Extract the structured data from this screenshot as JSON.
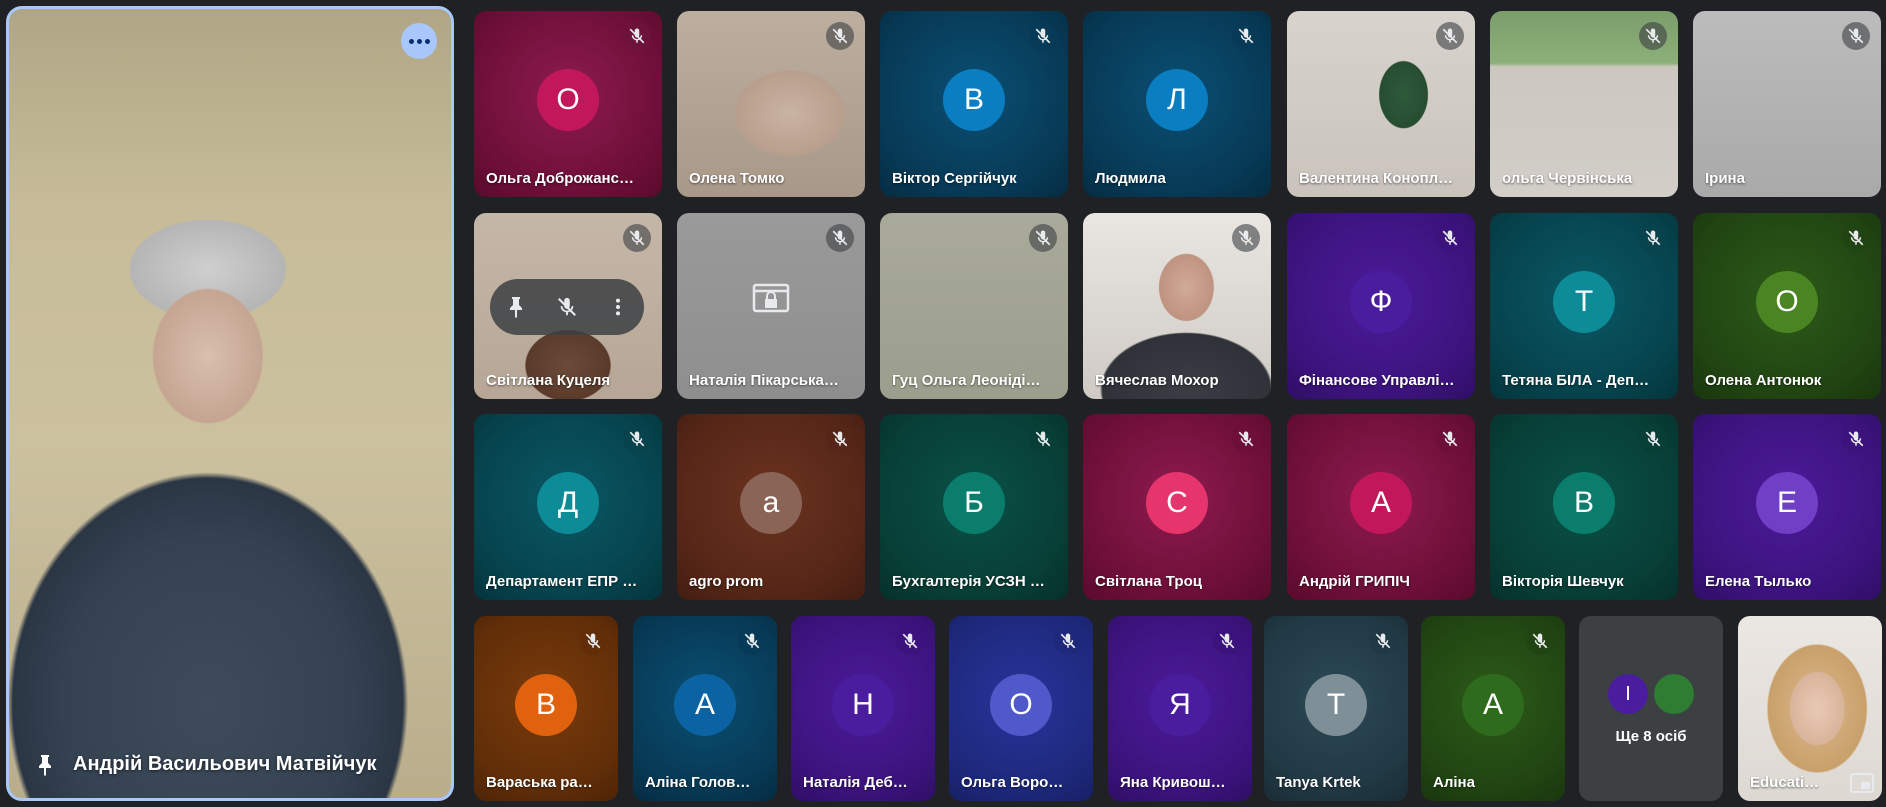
{
  "featured": {
    "name": "Андрій Васильович Матвійчук",
    "icons": {
      "pin": "pin-icon",
      "more": "more-options-icon"
    }
  },
  "colors": {
    "accent": "#a8c7fa",
    "background": "#202124"
  },
  "tiles": [
    {
      "name": "Ольга Доброжанс…",
      "initial": "О",
      "bg": "radial-gradient(circle at 50% 45%, #8e1b4f 0%, #6d0f38 70%, #5a0a2d 100%)",
      "avatar": "#c2185b",
      "mic": "#6d1339"
    },
    {
      "name": "Олена Томко",
      "initial": "",
      "bg": "radial-gradient(ellipse 90px 70px at 60% 55%, #c9b3a3 0%, #b89f8d 60%, transparent 62%), linear-gradient(180deg,#bdae9f,#a89888)",
      "avatar": "",
      "mic": "rgba(60,64,67,.6)"
    },
    {
      "name": "Віктор Сергійчук",
      "initial": "В",
      "bg": "radial-gradient(circle at 50% 45%, #0a4f73 0%, #073a56 70%, #052c42 100%)",
      "avatar": "#0b7dc1",
      "mic": "#073a56"
    },
    {
      "name": "Людмила",
      "initial": "Л",
      "bg": "radial-gradient(circle at 50% 45%, #0a4f73 0%, #073a56 70%, #052c42 100%)",
      "avatar": "#0b7dc1",
      "mic": "#073a56"
    },
    {
      "name": "Валентина Конопл…",
      "initial": "",
      "bg": "radial-gradient(ellipse 40px 55px at 62% 45%, #2e5a3a 0%, #274d31 60%, transparent 62%), linear-gradient(180deg,#d8d3cd,#c9c3bc)",
      "avatar": "",
      "mic": "rgba(60,64,67,.6)"
    },
    {
      "name": "ольга Червінська",
      "initial": "",
      "bg": "linear-gradient(180deg,#7a9d6a 0%,#8db07a 28%,#ccc7bf 30%,#d2cec8 100%)",
      "avatar": "",
      "mic": "rgba(60,64,67,.6)"
    },
    {
      "name": "Ірина",
      "initial": "",
      "bg": "linear-gradient(180deg,#bcbcbc,#a9a9a9)",
      "avatar": "",
      "mic": "rgba(60,64,67,.6)"
    },
    {
      "name": "Світлана Куцеля",
      "initial": "",
      "bg": "radial-gradient(ellipse 60px 50px at 50% 82%, #6b4a39 0%, #5a3a2a 70%, transparent 72%), linear-gradient(180deg,#c5b7a8,#b7a696)",
      "avatar": "",
      "mic": "rgba(60,64,67,.6)",
      "hover": true
    },
    {
      "name": "Наталія Пікарська…",
      "initial": "",
      "bg": "linear-gradient(180deg,#9a9a9a,#8e8e8e)",
      "avatar": "",
      "mic": "rgba(60,64,67,.6)",
      "lock": true
    },
    {
      "name": "Гуц Ольга Леоніді…",
      "initial": "",
      "bg": "linear-gradient(180deg,#a9aa9a,#9c9e8d)",
      "avatar": "",
      "mic": "rgba(60,64,67,.6)"
    },
    {
      "name": "Вячеслав Мохор",
      "initial": "",
      "bg": "radial-gradient(ellipse 45px 55px at 55% 40%, #d1aa98 0%, #bf9380 60%, transparent 62%), radial-gradient(ellipse 120px 80px at 55% 95%, #3a3d44 0%, #2f3238 70%, transparent 72%), linear-gradient(180deg,#e9e6e2,#cfcac4)",
      "avatar": "",
      "mic": "rgba(60,64,67,.6)"
    },
    {
      "name": "Фінансове Управлі…",
      "initial": "Ф",
      "bg": "radial-gradient(circle at 50% 45%, #4b1b9a 0%, #3c137d 70%, #300e66 100%)",
      "avatar": "#4a1c9e",
      "mic": "#3c137d"
    },
    {
      "name": "Тетяна БІЛА - Деп…",
      "initial": "Т",
      "bg": "radial-gradient(circle at 50% 45%, #0a5864 0%, #06434d 70%, #04343c 100%)",
      "avatar": "#0d8b97",
      "mic": "#06434d"
    },
    {
      "name": "Олена Антонюк",
      "initial": "О",
      "bg": "radial-gradient(circle at 50% 45%, #2c5a18 0%, #214512 70%, #19360d 100%)",
      "avatar": "#4a8423",
      "mic": "#214512"
    },
    {
      "name": "Департамент ЕПР …",
      "initial": "Д",
      "bg": "radial-gradient(circle at 50% 45%, #0a5864 0%, #06434d 70%, #04343c 100%)",
      "avatar": "#0d8b97",
      "mic": "#06434d"
    },
    {
      "name": "agro prom",
      "initial": "a",
      "bg": "radial-gradient(circle at 50% 45%, #6b3320 0%, #552617 70%, #431d11 100%)",
      "avatar": "#8a6557",
      "mic": "#552617"
    },
    {
      "name": "Бухгалтерія УСЗН …",
      "initial": "Б",
      "bg": "radial-gradient(circle at 50% 45%, #0a5147 0%, #073e36 70%, #05302a 100%)",
      "avatar": "#0a7d6c",
      "mic": "#073e36"
    },
    {
      "name": "Світлана Троц",
      "initial": "С",
      "bg": "radial-gradient(circle at 50% 45%, #8e1b4f 0%, #6d0f38 70%, #5a0a2d 100%)",
      "avatar": "#e6346c",
      "mic": "#6d0f38"
    },
    {
      "name": "Андрій ГРИПІЧ",
      "initial": "А",
      "bg": "radial-gradient(circle at 50% 45%, #8e1b4f 0%, #6d0f38 70%, #5a0a2d 100%)",
      "avatar": "#c2185b",
      "mic": "#6d0f38"
    },
    {
      "name": "Вікторія Шевчук",
      "initial": "В",
      "bg": "radial-gradient(circle at 50% 45%, #0a5147 0%, #073e36 70%, #05302a 100%)",
      "avatar": "#0a7d6c",
      "mic": "#073e36"
    },
    {
      "name": "Елена Тылько",
      "initial": "Е",
      "bg": "radial-gradient(circle at 50% 45%, #4b1b9a 0%, #3c137d 70%, #300e66 100%)",
      "avatar": "#6f3fc5",
      "mic": "#3c137d"
    },
    {
      "name": "Вараська ра…",
      "initial": "В",
      "bg": "radial-gradient(circle at 50% 45%, #7a3b0c 0%, #612e08 70%, #4d2406 100%)",
      "avatar": "#e0620f",
      "mic": "#612e08"
    },
    {
      "name": "Аліна Голов…",
      "initial": "А",
      "bg": "radial-gradient(circle at 50% 45%, #0a4f73 0%, #073a56 70%, #052c42 100%)",
      "avatar": "#0b63a4",
      "mic": "#073a56"
    },
    {
      "name": "Наталія Деб…",
      "initial": "Н",
      "bg": "radial-gradient(circle at 50% 45%, #4b1b9a 0%, #3c137d 70%, #300e66 100%)",
      "avatar": "#4a1c9e",
      "mic": "#3c137d"
    },
    {
      "name": "Ольга Воро…",
      "initial": "О",
      "bg": "radial-gradient(circle at 50% 45%, #27349a 0%, #1e297c 70%, #172066 100%)",
      "avatar": "#5059c9",
      "mic": "#1e297c"
    },
    {
      "name": "Яна Кривош…",
      "initial": "Я",
      "bg": "radial-gradient(circle at 50% 45%, #4b1b9a 0%, #3c137d 70%, #300e66 100%)",
      "avatar": "#4a1c9e",
      "mic": "#3c137d"
    },
    {
      "name": "Tanya Krtek",
      "initial": "T",
      "bg": "radial-gradient(circle at 50% 45%, #2c4a55 0%, #213944 70%, #192c35 100%)",
      "avatar": "#7e8f97",
      "mic": "#213944"
    },
    {
      "name": "Аліна",
      "initial": "А",
      "bg": "radial-gradient(circle at 50% 45%, #2c5a18 0%, #214512 70%, #19360d 100%)",
      "avatar": "#2e6b1c",
      "mic": "#214512"
    },
    {
      "name": "",
      "initial": "",
      "bg": "#3c4043",
      "avatar": "",
      "mic": "",
      "morePeople": true
    },
    {
      "name": "Educati…",
      "initial": "",
      "bg": "radial-gradient(ellipse 45px 60px at 55% 50%, #e9c9b4 0%, #d9b49b 60%, transparent 62%), radial-gradient(ellipse 70px 90px at 55% 50%, #d9b88d 0%, #c9a06a 70%, transparent 72%), linear-gradient(180deg,#ebe7e3,#ddd8d2)",
      "avatar": "",
      "mic": "",
      "pip": true
    }
  ],
  "more_people": {
    "label": "Ще 8 осіб",
    "avatars": [
      {
        "initial": "І",
        "color": "#4a1c9e"
      },
      {
        "initial": "",
        "color": "#2e7d32"
      }
    ]
  }
}
